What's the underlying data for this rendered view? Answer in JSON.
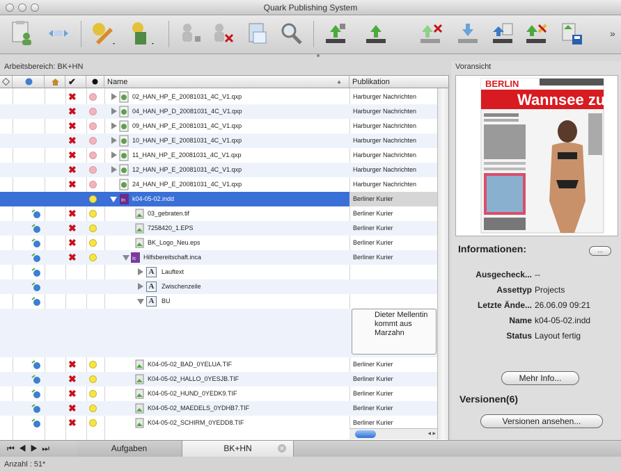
{
  "window": {
    "title": "Quark Publishing System"
  },
  "left_pane": {
    "label": "Arbeitsbereich: BK+HN",
    "columns": {
      "name": "Name",
      "publication": "Publikation"
    }
  },
  "rows": [
    {
      "name": "02_HAN_HP_E_20081031_4C_V1.qxp",
      "pub": "Harburger Nachrichten"
    },
    {
      "name": "04_HAN_HP_D_20081031_4C_V1.qxp",
      "pub": "Harburger Nachrichten"
    },
    {
      "name": "09_HAN_HP_E_20081031_4C_V1.qxp",
      "pub": "Harburger Nachrichten"
    },
    {
      "name": "10_HAN_HP_E_20081031_4C_V1.qxp",
      "pub": "Harburger Nachrichten"
    },
    {
      "name": "11_HAN_HP_E_20081031_4C_V1.qxp",
      "pub": "Harburger Nachrichten"
    },
    {
      "name": "12_HAN_HP_E_20081031_4C_V1.qxp",
      "pub": "Harburger Nachrichten"
    },
    {
      "name": "24_HAN_HP_E_20081031_4C_V1.qxp",
      "pub": "Harburger Nachrichten"
    },
    {
      "name": "k04-05-02.indd",
      "pub": "Berliner Kurier"
    },
    {
      "name": "03_gebraten.tif",
      "pub": "Berliner Kurier"
    },
    {
      "name": "7258420_1.EPS",
      "pub": "Berliner Kurier"
    },
    {
      "name": "BK_Logo_Neu.eps",
      "pub": "Berliner Kurier"
    },
    {
      "name": "Hilfsbereitschaft.inca",
      "pub": "Berliner Kurier"
    },
    {
      "name": "Lauftext",
      "pub": ""
    },
    {
      "name": "Zwischenzeile",
      "pub": ""
    },
    {
      "name": "BU",
      "pub": ""
    },
    {
      "name": "K04-05-02_BAD_0YELUA.TIF",
      "pub": "Berliner Kurier"
    },
    {
      "name": "K04-05-02_HALLO_0YESJB.TIF",
      "pub": "Berliner Kurier"
    },
    {
      "name": "K04-05-02_HUND_0YEDK9.TIF",
      "pub": "Berliner Kurier"
    },
    {
      "name": "K04-05-02_MAEDELS_0YDHB7.TIF",
      "pub": "Berliner Kurier"
    },
    {
      "name": "K04-05-02_SCHIRM_0YEDD8.TIF",
      "pub": "Berliner Kurier"
    }
  ],
  "note_text": "Dieter Mellentin kommt aus Marzahn",
  "preview": {
    "label": "Voransicht",
    "headline_brand": "BERLIN",
    "headline": "Wannsee zu"
  },
  "info": {
    "title": "Informationen:",
    "small_button": "...",
    "fields": [
      {
        "key": "Ausgecheck...",
        "value": "--"
      },
      {
        "key": "Assettyp",
        "value": "Projects"
      },
      {
        "key": "Letzte Ände...",
        "value": "26.06.09 09:21"
      },
      {
        "key": "Name",
        "value": "k04-05-02.indd"
      },
      {
        "key": "Status",
        "value": "Layout fertig"
      }
    ],
    "more_button": "Mehr Info..."
  },
  "versions": {
    "title": "Versionen(6)",
    "button": "Versionen ansehen..."
  },
  "tabs": [
    {
      "label": "Aufgaben"
    },
    {
      "label": "BK+HN"
    }
  ],
  "status": "Anzahl : 51*",
  "icons": [
    "checkout-icon",
    "search-icon",
    "upload-icon",
    "download-icon",
    "delete-icon",
    "save-icon"
  ]
}
